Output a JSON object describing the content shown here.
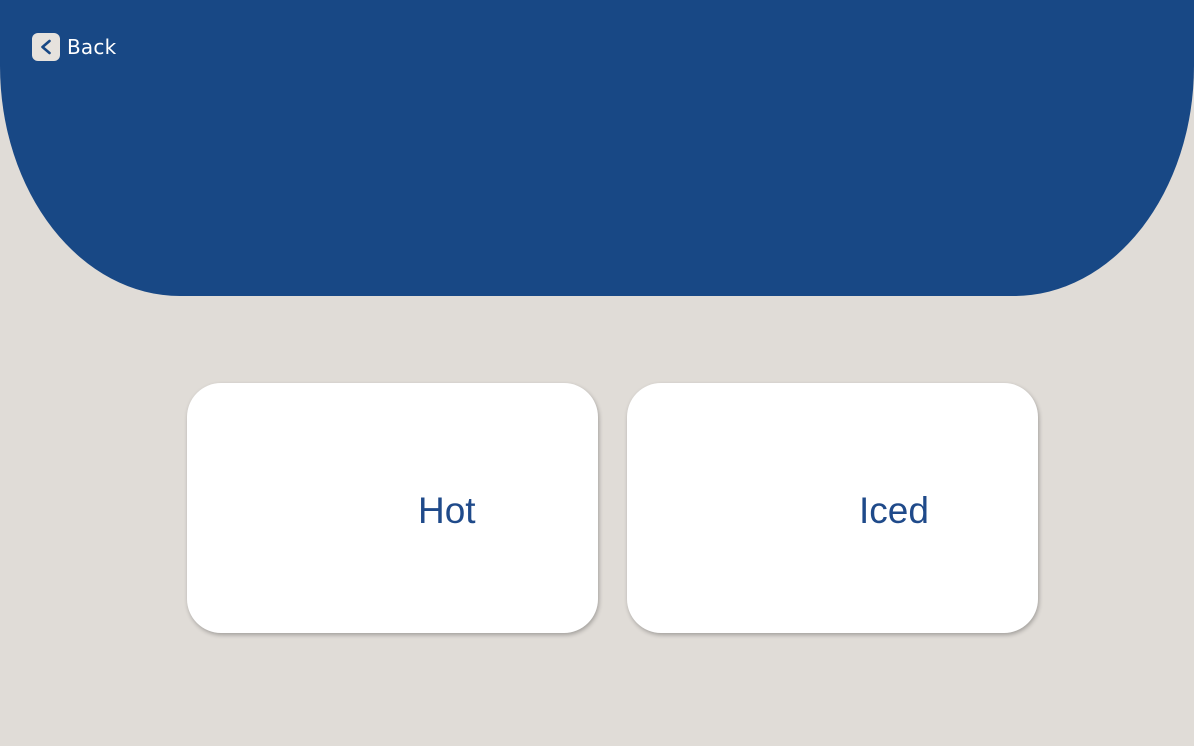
{
  "header": {
    "back_label": "Back",
    "back_icon": "chevron-left-icon",
    "background_color": "#184885"
  },
  "options": [
    {
      "label": "Hot"
    },
    {
      "label": "Iced"
    }
  ],
  "colors": {
    "page_background": "#e0dcd7",
    "card_background": "#ffffff",
    "option_text": "#1f4a8a",
    "back_icon_background": "#e6e2dd"
  }
}
